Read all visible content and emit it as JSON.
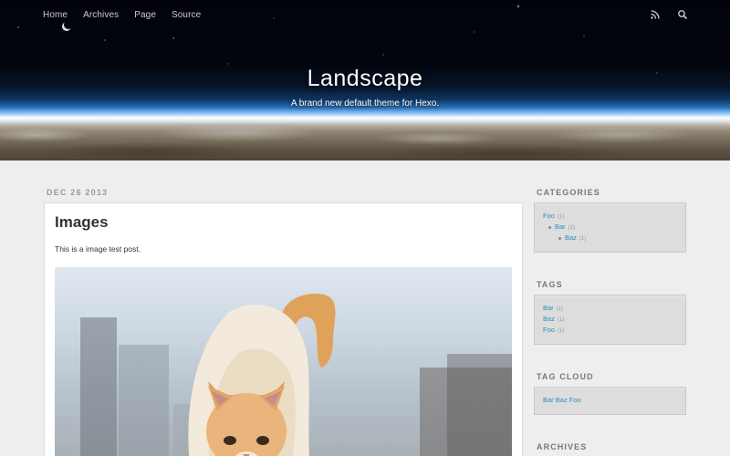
{
  "header": {
    "title": "Landscape",
    "subtitle": "A brand new default theme for Hexo.",
    "nav": [
      "Home",
      "Archives",
      "Page",
      "Source"
    ],
    "icons": [
      "rss-icon",
      "search-icon"
    ]
  },
  "post": {
    "date": "DEC 26 2013",
    "title": "Images",
    "text": "This is a image test post."
  },
  "sidebar": {
    "categories": {
      "title": "CATEGORIES",
      "items": [
        {
          "label": "Foo",
          "count": "(1)"
        },
        {
          "label": "Bar",
          "count": "(1)"
        },
        {
          "label": "Baz",
          "count": "(1)"
        }
      ]
    },
    "tags": {
      "title": "TAGS",
      "items": [
        {
          "label": "Bar",
          "count": "(1)"
        },
        {
          "label": "Baz",
          "count": "(1)"
        },
        {
          "label": "Foo",
          "count": "(1)"
        }
      ]
    },
    "tag_cloud": {
      "title": "TAG CLOUD",
      "items": [
        "Bar",
        "Baz",
        "Foo"
      ]
    },
    "archives": {
      "title": "ARCHIVES"
    }
  },
  "colors": {
    "link": "#258fb8",
    "background": "#eeeeee",
    "widget": "#dddddd"
  }
}
